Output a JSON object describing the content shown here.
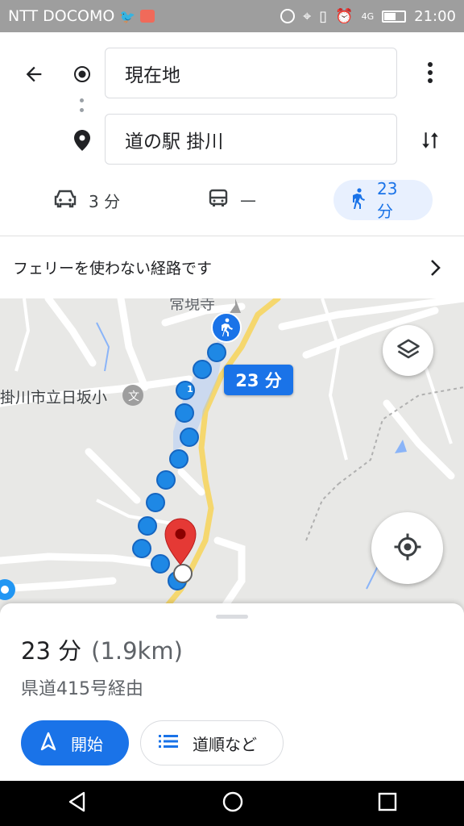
{
  "status_bar": {
    "carrier": "NTT DOCOMO",
    "network": "4G",
    "time": "21:00"
  },
  "search": {
    "origin": "現在地",
    "destination": "道の駅 掛川"
  },
  "modes": {
    "car": "3 分",
    "transit": "—",
    "walk": "23 分"
  },
  "notice": "フェリーを使わない経路です",
  "map": {
    "label_temple": "常現寺",
    "label_school": "掛川市立日坂小",
    "label_school_icon": "文",
    "route_badge": "1",
    "duration_badge": "23 分"
  },
  "sheet": {
    "duration": "23 分",
    "distance": "(1.9km)",
    "via": "県道415号経由",
    "start_label": "開始",
    "steps_label": "道順など"
  },
  "colors": {
    "accent": "#1a73e8",
    "route_dot": "#1e88e5",
    "pin": "#e53935"
  }
}
